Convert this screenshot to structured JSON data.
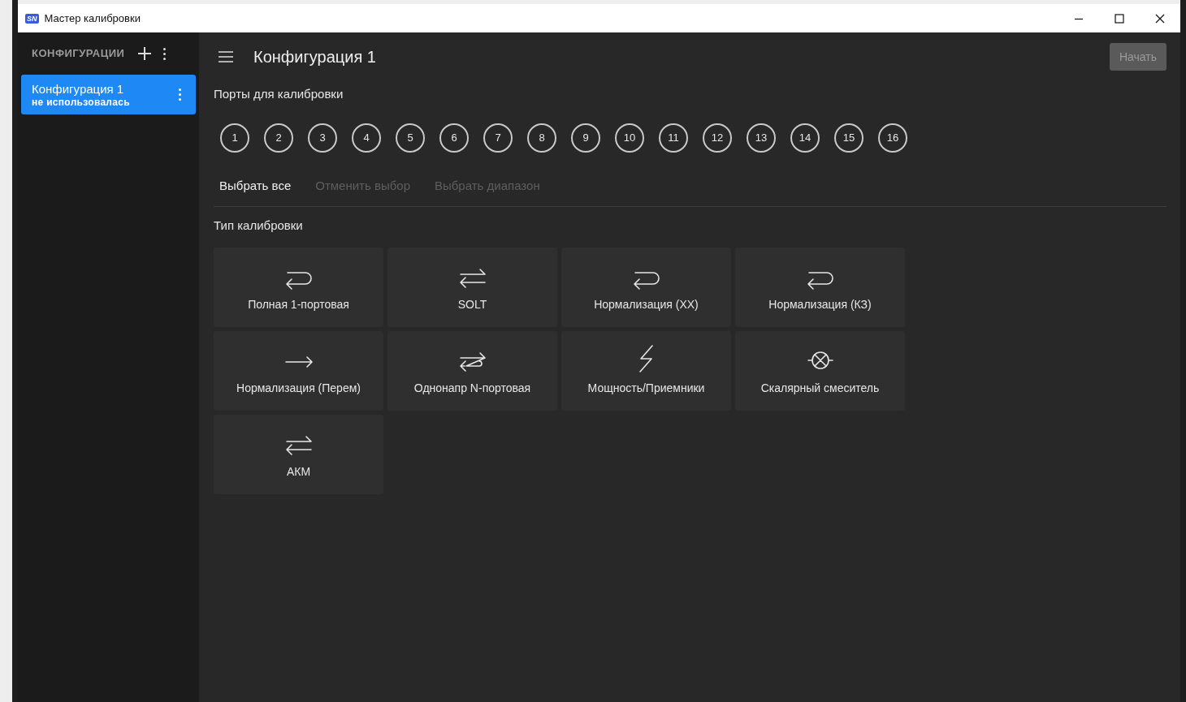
{
  "window": {
    "logo": "SN",
    "title": "Мастер калибровки"
  },
  "sidebar": {
    "header": "КОНФИГУРАЦИИ",
    "items": [
      {
        "title": "Конфигурация 1",
        "subtitle": "не использовалась",
        "selected": true
      }
    ]
  },
  "main": {
    "title": "Конфигурация 1",
    "start_button": {
      "label": "Начать",
      "disabled": true
    },
    "ports": {
      "label": "Порты для калибровки",
      "items": [
        {
          "label": "1",
          "selected": false
        },
        {
          "label": "2",
          "selected": false
        },
        {
          "label": "3",
          "selected": false
        },
        {
          "label": "4",
          "selected": false
        },
        {
          "label": "5",
          "selected": false
        },
        {
          "label": "6",
          "selected": false
        },
        {
          "label": "7",
          "selected": false
        },
        {
          "label": "8",
          "selected": false
        },
        {
          "label": "9",
          "selected": false
        },
        {
          "label": "10",
          "selected": false
        },
        {
          "label": "11",
          "selected": false
        },
        {
          "label": "12",
          "selected": false
        },
        {
          "label": "13",
          "selected": false
        },
        {
          "label": "14",
          "selected": false
        },
        {
          "label": "15",
          "selected": false
        },
        {
          "label": "16",
          "selected": false
        }
      ],
      "actions": [
        {
          "label": "Выбрать все",
          "disabled": false
        },
        {
          "label": "Отменить выбор",
          "disabled": true
        },
        {
          "label": "Выбрать диапазон",
          "disabled": true
        }
      ]
    },
    "calibration_type": {
      "label": "Тип калибровки",
      "items": [
        {
          "label": "Полная 1-портовая",
          "kind": "reflect"
        },
        {
          "label": "SOLT",
          "kind": "two-port"
        },
        {
          "label": "Нормализация (ХХ)",
          "kind": "reflect"
        },
        {
          "label": "Нормализация (КЗ)",
          "kind": "reflect"
        },
        {
          "label": "Нормализация (Перем)",
          "kind": "thru"
        },
        {
          "label": "Однонапр N-портовая",
          "kind": "one-way"
        },
        {
          "label": "Мощность/Приемники",
          "kind": "power"
        },
        {
          "label": "Скалярный смеситель",
          "kind": "mixer"
        },
        {
          "label": "АКМ",
          "kind": "two-port"
        }
      ]
    }
  }
}
